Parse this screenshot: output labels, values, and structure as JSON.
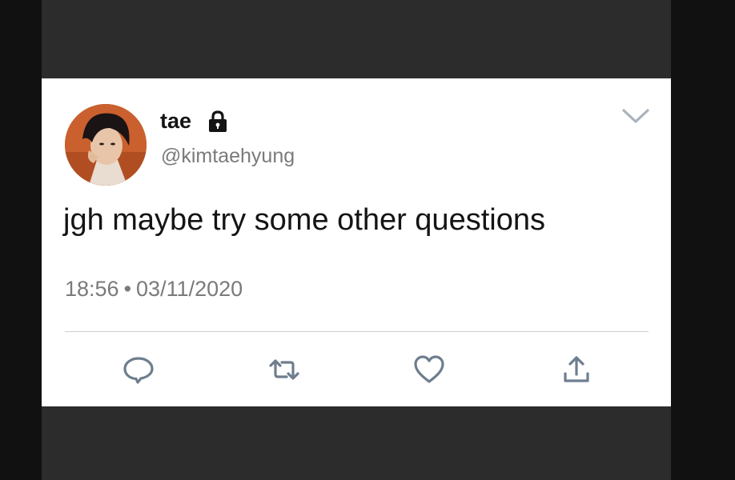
{
  "tweet": {
    "display_name": "tae",
    "handle": "@kimtaehyung",
    "text": "jgh maybe try some other questions",
    "time": "18:56",
    "separator": "•",
    "date": "03/11/2020"
  },
  "icons": {
    "protected": "lock-icon",
    "menu": "chevron-down-icon",
    "reply": "reply-icon",
    "retweet": "retweet-icon",
    "like": "heart-icon",
    "share": "share-icon"
  },
  "colors": {
    "text": "#141414",
    "muted": "#7a7a7a",
    "icon": "#6e7e8e",
    "card": "#ffffff",
    "frame": "#2c2c2c"
  }
}
